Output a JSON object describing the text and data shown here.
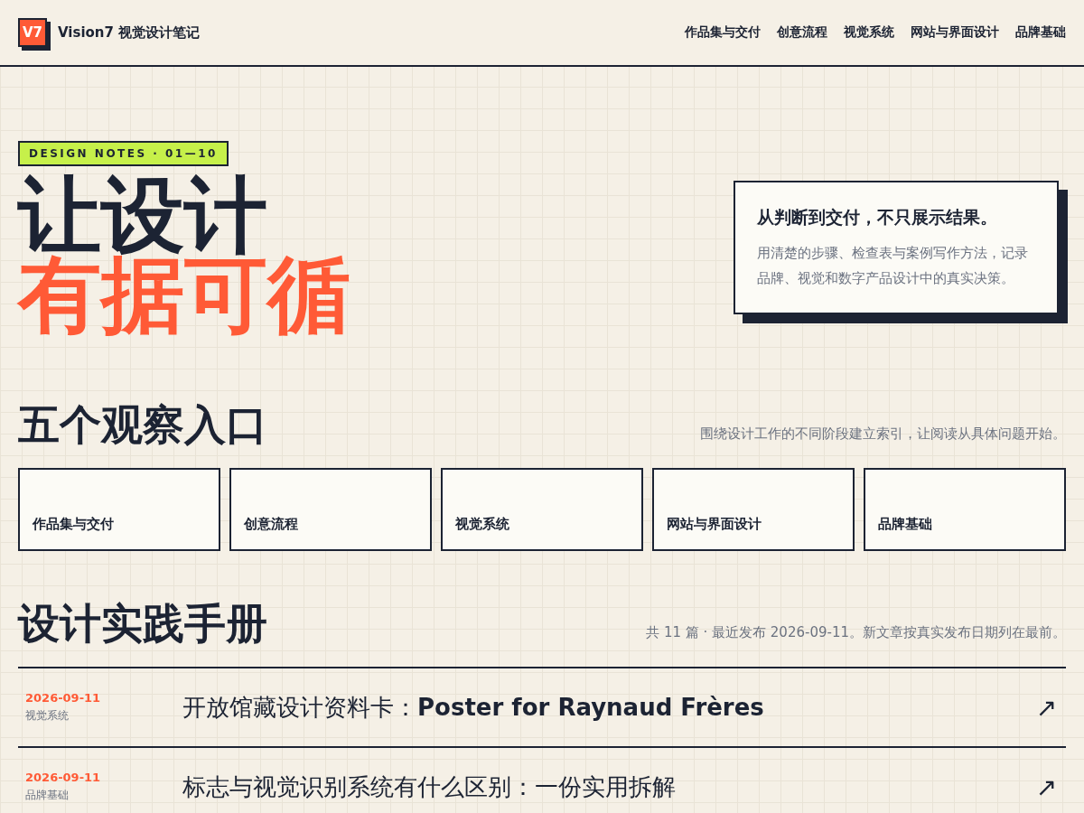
{
  "header": {
    "logo": "V7",
    "site_title": "Vision7 视觉设计笔记",
    "nav": [
      "作品集与交付",
      "创意流程",
      "视觉系统",
      "网站与界面设计",
      "品牌基础"
    ]
  },
  "hero": {
    "tag": "DESIGN NOTES · 01—10",
    "title_line_1": "让设计",
    "title_line_2": "有据可循",
    "card_title": "从判断到交付，不只展示结果。",
    "card_text": "用清楚的步骤、检查表与案例写作方法，记录品牌、视觉和数字产品设计中的真实决策。"
  },
  "topics": {
    "heading": "五个观察入口",
    "note": "围绕设计工作的不同阶段建立索引，让阅读从具体问题开始。",
    "items": [
      "作品集与交付",
      "创意流程",
      "视觉系统",
      "网站与界面设计",
      "品牌基础"
    ]
  },
  "handbook": {
    "heading": "设计实践手册",
    "note": "共 11 篇 · 最近发布 2026-09-11。新文章按真实发布日期列在最前。",
    "articles": [
      {
        "date": "2026-09-11",
        "category": "视觉系统",
        "title": "开放馆藏设计资料卡：**Poster for Raynaud Frères**",
        "arrow": "↗"
      },
      {
        "date": "2026-09-11",
        "category": "品牌基础",
        "title": "标志与视觉识别系统有什么区别：一份实用拆解",
        "arrow": "↗"
      }
    ]
  }
}
